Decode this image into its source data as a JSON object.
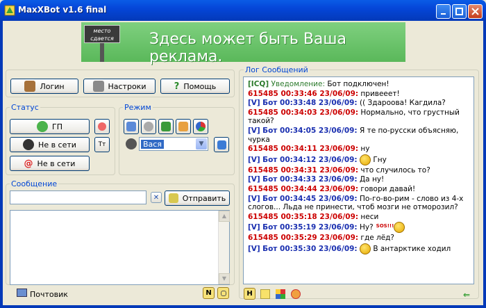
{
  "window": {
    "title": "MaxXBot v1.6 final"
  },
  "banner": {
    "sign_text": "место сдается",
    "ad_text": "Здесь может быть Ваша реклама."
  },
  "toolbar": {
    "login_label": "Логин",
    "settings_label": "Настроки",
    "help_label": "Помощь"
  },
  "status": {
    "legend": "Статус",
    "btn1_label": "ГП",
    "btn2_label": "Не в сети",
    "btn3_label": "Не в сети",
    "tt_label": "Tт"
  },
  "mode": {
    "legend": "Режим",
    "selected_value": "Вася"
  },
  "message": {
    "legend": "Сообщение",
    "input_value": "",
    "send_label": "Отправить"
  },
  "footer": {
    "mail_label": "Почтовик",
    "n_label": "N"
  },
  "log": {
    "legend": "Лог Сообщений",
    "entries": [
      {
        "prefix": "[ICQ]",
        "type": "icq",
        "notice": "Уведомление:",
        "text": " Бот подключен!"
      },
      {
        "name": "615485 00:33:46 23/06/09:",
        "type": "user",
        "text": " привееет!"
      },
      {
        "tag": "[V]",
        "name": "Бот 00:33:48 23/06/09:",
        "type": "bot",
        "text": " (( Здароова! Кагдила?"
      },
      {
        "name": "615485 00:34:03 23/06/09:",
        "type": "user",
        "text": " Нормально, что грустный такой?"
      },
      {
        "tag": "[V]",
        "name": "Бот 00:34:05 23/06/09:",
        "type": "bot",
        "text": " Я те по-русски объясняю, чурка"
      },
      {
        "name": "615485 00:34:11 23/06/09:",
        "type": "user",
        "text": " ну"
      },
      {
        "tag": "[V]",
        "name": "Бот 00:34:12 23/06/09:",
        "type": "bot",
        "text": " Гну",
        "smile": true
      },
      {
        "name": "615485 00:34:31 23/06/09:",
        "type": "user",
        "text": " что случилось то?"
      },
      {
        "tag": "[V]",
        "name": "Бот 00:34:33 23/06/09:",
        "type": "bot",
        "text": " Да ну!"
      },
      {
        "name": "615485 00:34:44 23/06/09:",
        "type": "user",
        "text": " говори давай!"
      },
      {
        "tag": "[V]",
        "name": "Бот 00:34:45 23/06/09:",
        "type": "bot",
        "text": " По-го-во-рим - слово из 4-х слогов... Льда не принести, чтоб мозги не отморозил?"
      },
      {
        "name": "615485 00:35:18 23/06/09:",
        "type": "user",
        "text": " неси"
      },
      {
        "tag": "[V]",
        "name": "Бот 00:35:19 23/06/09:",
        "type": "bot",
        "text": " Ну?",
        "sos": "SOS!!!"
      },
      {
        "name": "615485 00:35:29 23/06/09:",
        "type": "user",
        "text": " где лёд?"
      },
      {
        "tag": "[V]",
        "name": "Бот 00:35:30 23/06/09:",
        "type": "bot",
        "text": " В антарктике ходил",
        "smile": true
      }
    ]
  }
}
